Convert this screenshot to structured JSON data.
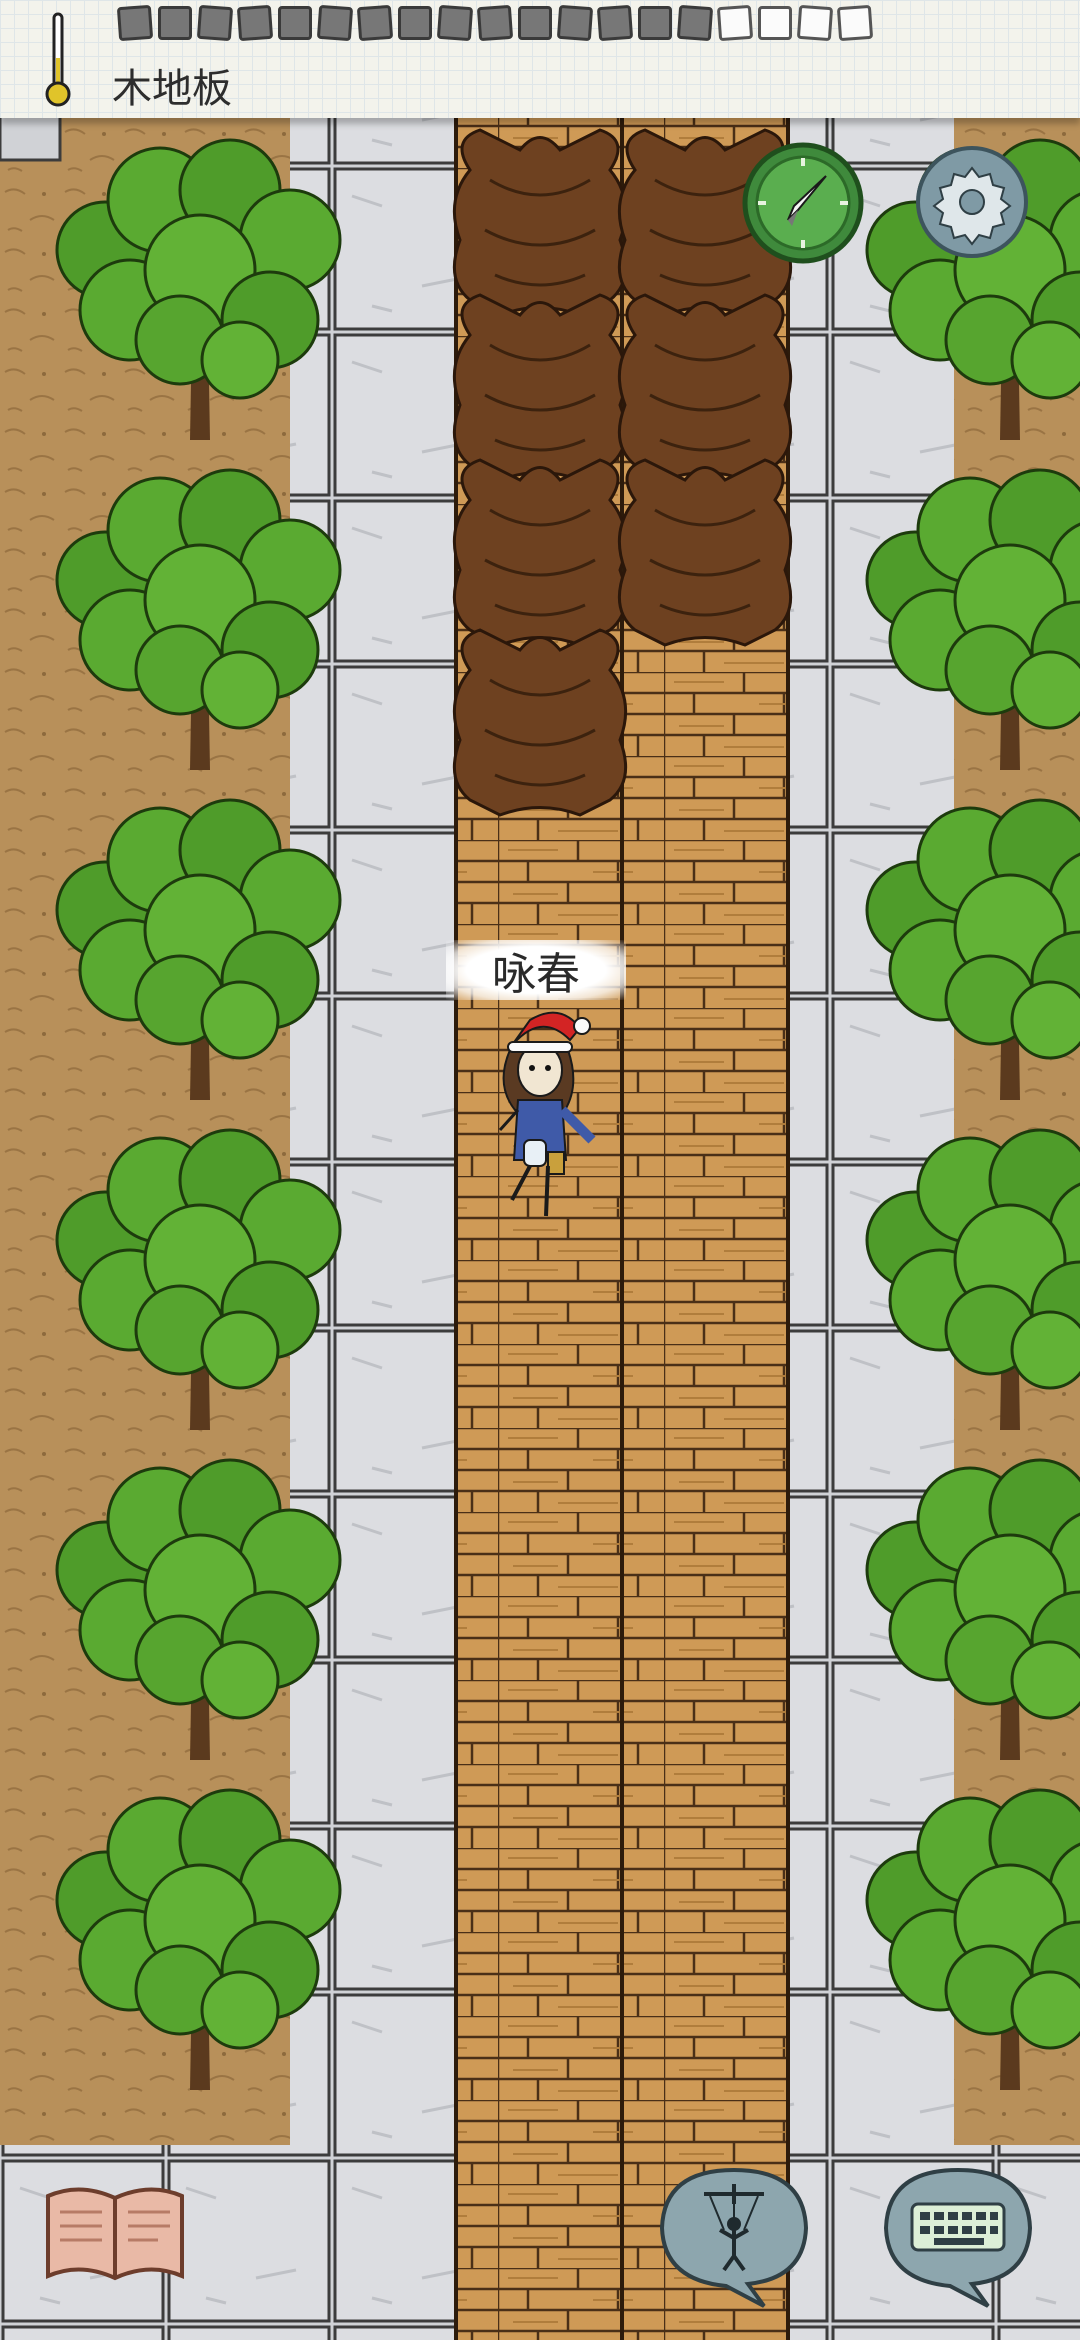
{
  "hud": {
    "tile_name": "木地板",
    "icons": {
      "temperature": "thermometer-icon",
      "compass": "compass-icon",
      "settings": "gear-icon",
      "journal": "book-icon",
      "emote": "puppet-icon",
      "chat": "keyboard-icon"
    },
    "food_slots": [
      {
        "state": "filled"
      },
      {
        "state": "filled"
      },
      {
        "state": "filled"
      },
      {
        "state": "filled"
      },
      {
        "state": "filled"
      },
      {
        "state": "filled"
      },
      {
        "state": "filled"
      },
      {
        "state": "filled"
      },
      {
        "state": "filled"
      },
      {
        "state": "filled"
      },
      {
        "state": "filled"
      },
      {
        "state": "filled"
      },
      {
        "state": "filled"
      },
      {
        "state": "filled"
      },
      {
        "state": "filled"
      },
      {
        "state": "empty"
      },
      {
        "state": "empty"
      },
      {
        "state": "empty"
      },
      {
        "state": "empty"
      }
    ]
  },
  "player": {
    "name": "咏春",
    "hat": "santa-hat"
  },
  "colors": {
    "ground": "#b8905a",
    "stone": "#d4d6da",
    "wood": "#cf9a56",
    "rug": "#6e4120",
    "leaf": "#4f9c2a",
    "compass": "#3f8a3c",
    "gear": "#7f9aa5"
  }
}
